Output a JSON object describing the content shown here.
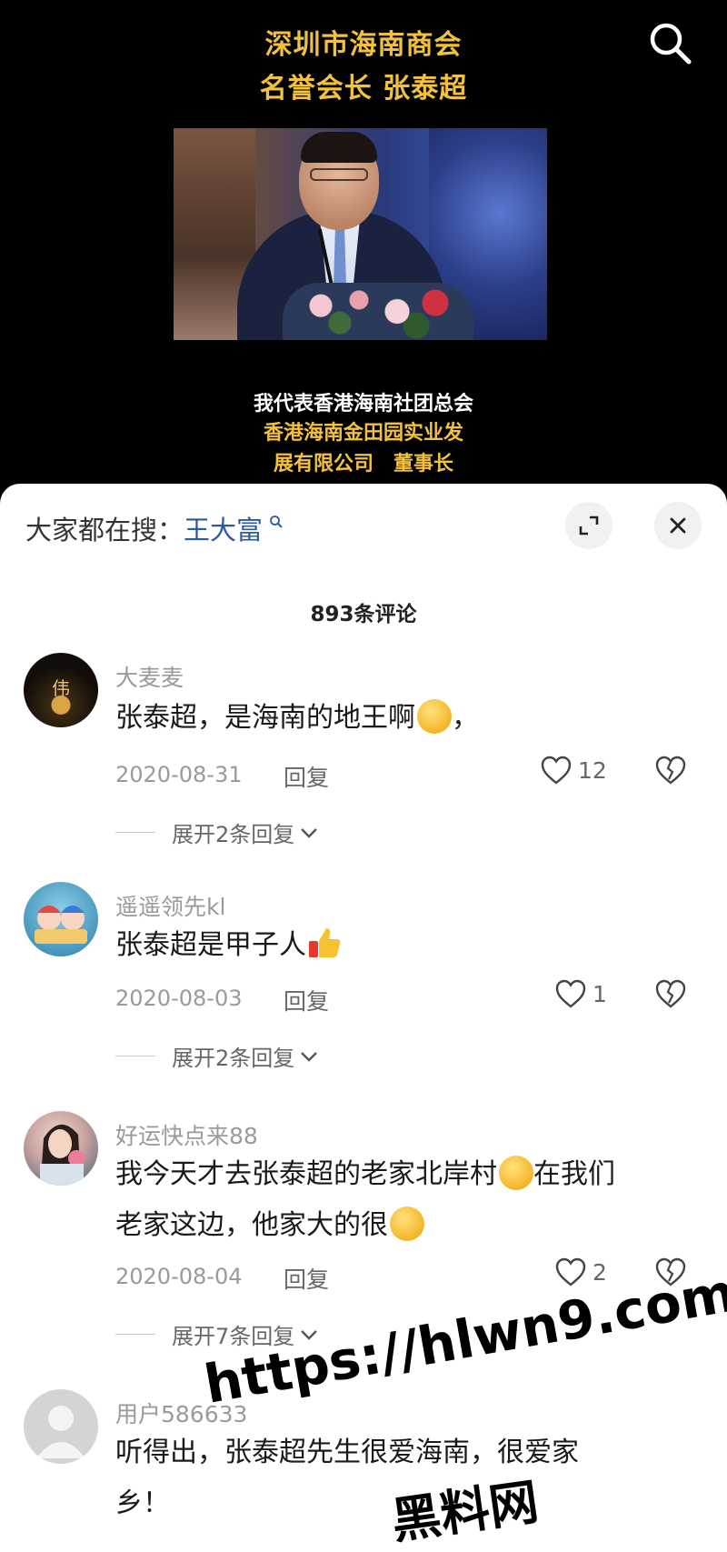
{
  "video": {
    "title_line1": "深圳市海南商会",
    "title_line2": "名誉会长 张泰超",
    "caption_line1": "我代表香港海南社团总会",
    "caption_line2": "香港海南金田园实业发",
    "caption_line3": "展有限公司　董事长",
    "search_icon": "search-icon"
  },
  "panel": {
    "search_prefix": "大家都在搜：",
    "search_keyword": "王大富",
    "expand_icon": "expand-icon",
    "close_icon": "close-icon",
    "comment_count": "893条评论"
  },
  "comments": [
    {
      "user": "大麦麦",
      "text": "张泰超，是海南的地王啊",
      "text_suffix": "，",
      "emoji": "rofl-emoji",
      "date": "2020-08-31",
      "reply_label": "回复",
      "likes": "12",
      "expand_label": "展开2条回复"
    },
    {
      "user": "遥遥领先kl",
      "text": "张泰超是甲子人",
      "emoji": "thumbs-up-emoji",
      "date": "2020-08-03",
      "reply_label": "回复",
      "likes": "1",
      "expand_label": "展开2条回复"
    },
    {
      "user": "好运快点来88",
      "text_line1": "我今天才去张泰超的老家北岸村",
      "text_line1_suffix": "在我们",
      "text_line2": "老家这边，他家大的很",
      "emoji": "rofl-emoji",
      "emoji2": "pleading-emoji",
      "date": "2020-08-04",
      "reply_label": "回复",
      "likes": "2",
      "expand_label": "展开7条回复"
    },
    {
      "user": "用户586633",
      "text_line1": "听得出，张泰超先生很爱海南，很爱家",
      "text_line2": "乡！"
    }
  ],
  "watermark": {
    "line1": "https://hlwn9.com",
    "line2": "黑料网"
  },
  "colors": {
    "title_gold": "#f2c23a",
    "keyword_blue": "#2a5aa0"
  }
}
